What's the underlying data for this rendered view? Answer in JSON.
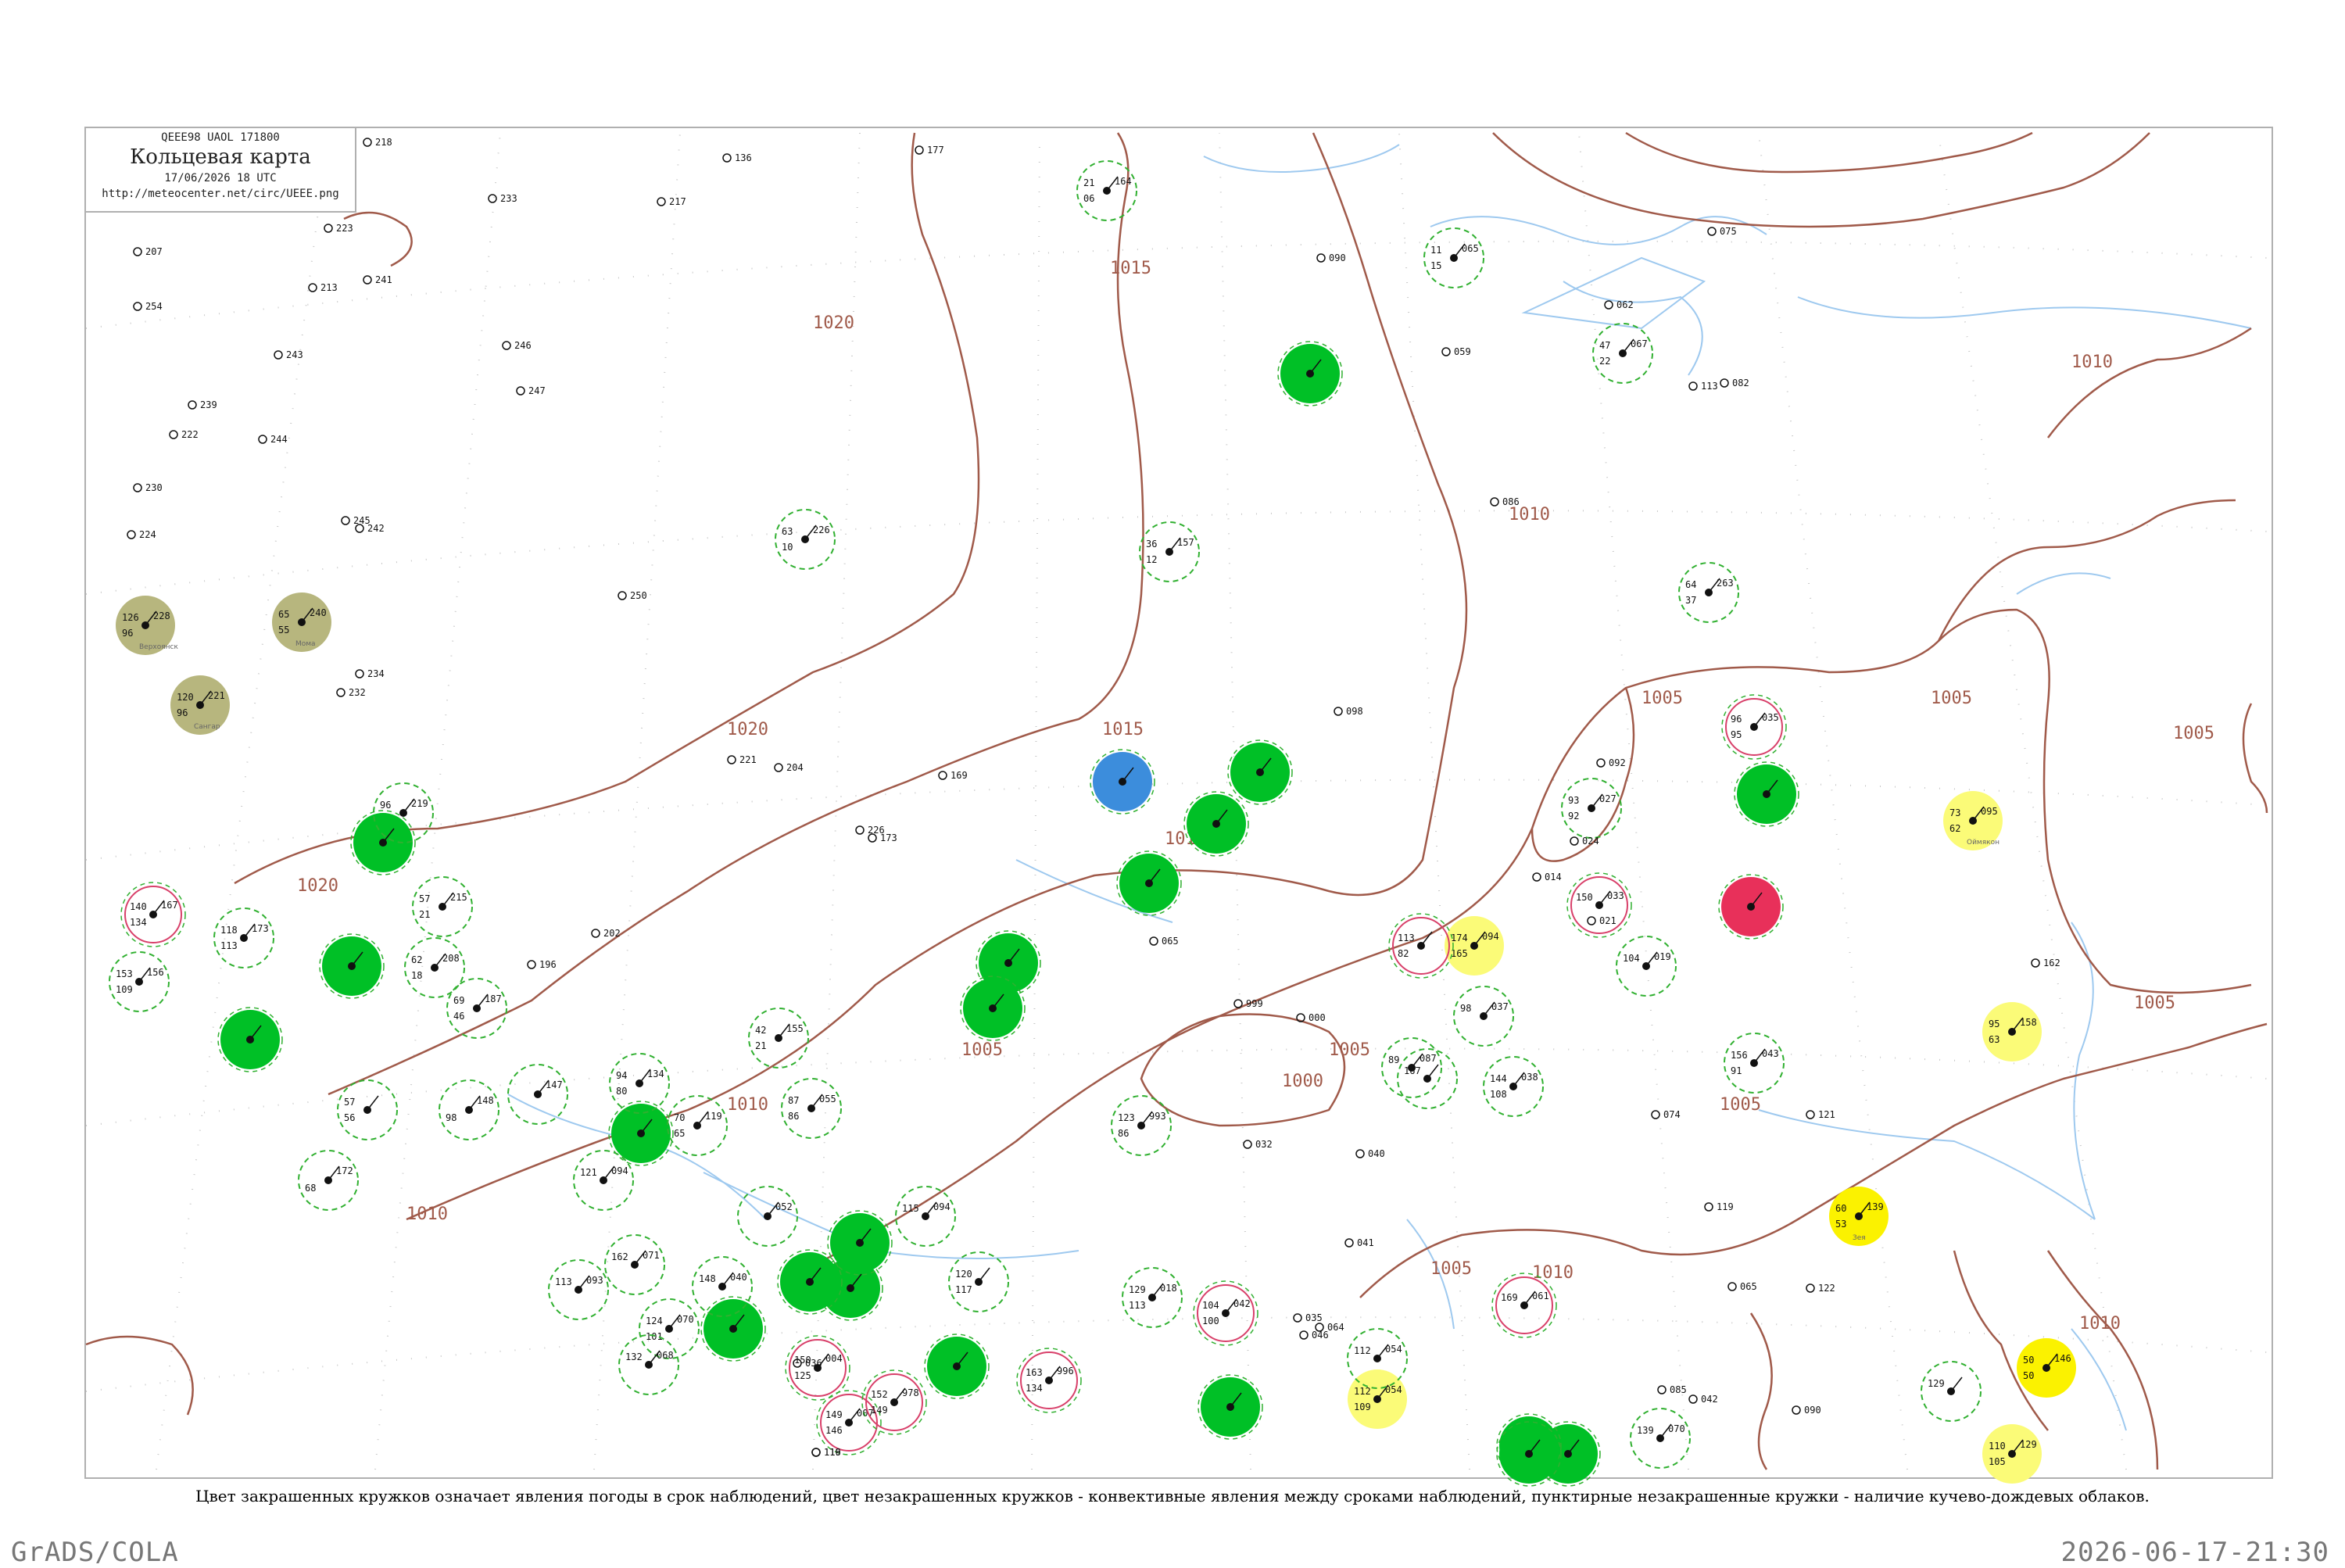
{
  "header": {
    "code": "QEEE98 UAOL 171800",
    "title": "Кольцевая карта",
    "date": "17/06/2026 18 UTC",
    "url": "http://meteocenter.net/circ/UEEE.png"
  },
  "caption": "Цвет закрашенных кружков означает явления погоды в срок наблюдений, цвет незакрашенных кружков - конвективные явления между сроками наблюдений, пунктирные незакрашенные кружки - наличие кучево-дождевых облаков.",
  "footer": {
    "left": "GrADS/COLA",
    "right": "2026-06-17-21:30"
  },
  "colors": {
    "isobar": "#a05a4a",
    "river": "#9ec9ef",
    "frame": "#b0b0b0",
    "grid_dots": "#c8c8c8",
    "fill_green": "#00c026",
    "fill_blue": "#3c8ddc",
    "fill_red": "#e8305a",
    "fill_yellow": "#fbfb78",
    "fill_bright_yellow": "#fbf200",
    "fill_olive": "#b7b67e",
    "ring_green_dashed": "#30b030",
    "ring_red": "#d8406a"
  },
  "isobar_labels": [
    "1020",
    "1020",
    "1020",
    "1015",
    "1015",
    "1015",
    "1010",
    "1010",
    "1010",
    "1010",
    "1010",
    "1005",
    "1005",
    "1005",
    "1005",
    "1005",
    "1005",
    "1005",
    "1005",
    "1000",
    "1010"
  ],
  "stations": [
    {
      "marker": "olive",
      "pressure": "228",
      "temp": "126",
      "dew": "96",
      "name": "Верхоянск"
    },
    {
      "marker": "olive",
      "pressure": "240",
      "temp": "65",
      "dew": "55",
      "name": "Мома"
    },
    {
      "marker": "olive",
      "pressure": "221",
      "temp": "120",
      "dew": "96",
      "name": "Сангар"
    },
    {
      "marker": "green",
      "pressure": "",
      "temp": "",
      "dew": "",
      "name": ""
    },
    {
      "marker": "green",
      "pressure": "",
      "temp": "",
      "dew": "",
      "name": ""
    },
    {
      "marker": "green",
      "pressure": "",
      "temp": "",
      "dew": "",
      "name": ""
    },
    {
      "marker": "green",
      "pressure": "",
      "temp": "",
      "dew": "",
      "name": ""
    },
    {
      "marker": "green",
      "pressure": "",
      "temp": "",
      "dew": "",
      "name": ""
    },
    {
      "marker": "green",
      "pressure": "",
      "temp": "",
      "dew": "",
      "name": ""
    },
    {
      "marker": "green",
      "pressure": "",
      "temp": "",
      "dew": "",
      "name": ""
    },
    {
      "marker": "green",
      "pressure": "",
      "temp": "",
      "dew": "",
      "name": ""
    },
    {
      "marker": "green",
      "pressure": "",
      "temp": "",
      "dew": "",
      "name": ""
    },
    {
      "marker": "green",
      "pressure": "",
      "temp": "",
      "dew": "",
      "name": ""
    },
    {
      "marker": "green",
      "pressure": "",
      "temp": "",
      "dew": "",
      "name": ""
    },
    {
      "marker": "green",
      "pressure": "",
      "temp": "",
      "dew": "",
      "name": ""
    },
    {
      "marker": "green",
      "pressure": "",
      "temp": "",
      "dew": "",
      "name": ""
    },
    {
      "marker": "green",
      "pressure": "",
      "temp": "",
      "dew": "",
      "name": ""
    },
    {
      "marker": "green",
      "pressure": "",
      "temp": "",
      "dew": "",
      "name": ""
    },
    {
      "marker": "green",
      "pressure": "",
      "temp": "",
      "dew": "",
      "name": ""
    },
    {
      "marker": "green",
      "pressure": "",
      "temp": "",
      "dew": "",
      "name": ""
    },
    {
      "marker": "green",
      "pressure": "",
      "temp": "",
      "dew": "",
      "name": ""
    },
    {
      "marker": "green",
      "pressure": "",
      "temp": "",
      "dew": "",
      "name": ""
    },
    {
      "marker": "green",
      "pressure": "",
      "temp": "",
      "dew": "",
      "name": ""
    },
    {
      "marker": "blue",
      "pressure": "",
      "temp": "",
      "dew": "",
      "name": ""
    },
    {
      "marker": "red",
      "pressure": "",
      "temp": "",
      "dew": "",
      "name": ""
    },
    {
      "marker": "yellow",
      "pressure": "094",
      "temp": "174",
      "dew": "165",
      "name": ""
    },
    {
      "marker": "yellow",
      "pressure": "095",
      "temp": "73",
      "dew": "62",
      "name": "Оймякон"
    },
    {
      "marker": "yellow",
      "pressure": "158",
      "temp": "95",
      "dew": "63",
      "name": ""
    },
    {
      "marker": "yellow",
      "pressure": "054",
      "temp": "112",
      "dew": "109",
      "name": ""
    },
    {
      "marker": "yellow",
      "pressure": "129",
      "temp": "110",
      "dew": "105",
      "name": ""
    },
    {
      "marker": "bright_yellow",
      "pressure": "139",
      "temp": "60",
      "dew": "53",
      "name": "Зея"
    },
    {
      "marker": "bright_yellow",
      "pressure": "146",
      "temp": "50",
      "dew": "50",
      "name": ""
    },
    {
      "marker": "ring_green",
      "pressure": "226",
      "temp": "63",
      "dew": "10",
      "name": ""
    },
    {
      "marker": "ring_green",
      "pressure": "164",
      "temp": "21",
      "dew": "06",
      "name": ""
    },
    {
      "marker": "ring_green",
      "pressure": "065",
      "temp": "11",
      "dew": "15",
      "name": ""
    },
    {
      "marker": "ring_green",
      "pressure": "067",
      "temp": "47",
      "dew": "22",
      "name": ""
    },
    {
      "marker": "ring_green",
      "pressure": "157",
      "temp": "36",
      "dew": "12",
      "name": ""
    },
    {
      "marker": "ring_green",
      "pressure": "263",
      "temp": "64",
      "dew": "37",
      "name": ""
    },
    {
      "marker": "ring_green",
      "pressure": "027",
      "temp": "93",
      "dew": "92",
      "name": ""
    },
    {
      "marker": "ring_green",
      "pressure": "219",
      "temp": "96",
      "dew": "",
      "name": ""
    },
    {
      "marker": "ring_green",
      "pressure": "215",
      "temp": "57",
      "dew": "21",
      "name": ""
    },
    {
      "marker": "ring_green",
      "pressure": "208",
      "temp": "62",
      "dew": "18",
      "name": ""
    },
    {
      "marker": "ring_green",
      "pressure": "156",
      "temp": "153",
      "dew": "109",
      "name": ""
    },
    {
      "marker": "ring_green",
      "pressure": "173",
      "temp": "118",
      "dew": "113",
      "name": ""
    },
    {
      "marker": "ring_green",
      "pressure": "187",
      "temp": "69",
      "dew": "46",
      "name": ""
    },
    {
      "marker": "ring_green",
      "pressure": "155",
      "temp": "42",
      "dew": "21",
      "name": ""
    },
    {
      "marker": "ring_green",
      "pressure": "055",
      "temp": "87",
      "dew": "86",
      "name": ""
    },
    {
      "marker": "ring_green",
      "pressure": "134",
      "temp": "94",
      "dew": "80",
      "name": ""
    },
    {
      "marker": "ring_green",
      "pressure": "119",
      "temp": "70",
      "dew": "65",
      "name": ""
    },
    {
      "marker": "ring_green",
      "pressure": "148",
      "temp": "",
      "dew": "98",
      "name": ""
    },
    {
      "marker": "ring_green",
      "pressure": "",
      "temp": "57",
      "dew": "56",
      "name": ""
    },
    {
      "marker": "ring_green",
      "pressure": "147",
      "temp": "",
      "dew": "",
      "name": ""
    },
    {
      "marker": "ring_green",
      "pressure": "172",
      "temp": "",
      "dew": "68",
      "name": ""
    },
    {
      "marker": "ring_green",
      "pressure": "094",
      "temp": "121",
      "dew": "",
      "name": ""
    },
    {
      "marker": "ring_green",
      "pressure": "071",
      "temp": "162",
      "dew": "",
      "name": ""
    },
    {
      "marker": "ring_green",
      "pressure": "093",
      "temp": "113",
      "dew": "",
      "name": ""
    },
    {
      "marker": "ring_green",
      "pressure": "070",
      "temp": "124",
      "dew": "101",
      "name": ""
    },
    {
      "marker": "ring_green",
      "pressure": "068",
      "temp": "132",
      "dew": "",
      "name": ""
    },
    {
      "marker": "ring_green",
      "pressure": "094",
      "temp": "115",
      "dew": "",
      "name": ""
    },
    {
      "marker": "ring_green",
      "pressure": "052",
      "temp": "",
      "dew": "",
      "name": ""
    },
    {
      "marker": "ring_green",
      "pressure": "040",
      "temp": "148",
      "dew": "",
      "name": ""
    },
    {
      "marker": "ring_green",
      "pressure": "",
      "temp": "120",
      "dew": "117",
      "name": ""
    },
    {
      "marker": "ring_green",
      "pressure": "993",
      "temp": "123",
      "dew": "86",
      "name": ""
    },
    {
      "marker": "ring_green",
      "pressure": "018",
      "temp": "129",
      "dew": "113",
      "name": ""
    },
    {
      "marker": "ring_green",
      "pressure": "037",
      "temp": "98",
      "dew": "",
      "name": ""
    },
    {
      "marker": "ring_green",
      "pressure": "087",
      "temp": "89",
      "dew": "",
      "name": ""
    },
    {
      "marker": "ring_green",
      "pressure": "",
      "temp": "167",
      "dew": "",
      "name": ""
    },
    {
      "marker": "ring_green",
      "pressure": "038",
      "temp": "144",
      "dew": "108",
      "name": ""
    },
    {
      "marker": "ring_green",
      "pressure": "019",
      "temp": "104",
      "dew": "",
      "name": ""
    },
    {
      "marker": "ring_green",
      "pressure": "043",
      "temp": "156",
      "dew": "91",
      "name": ""
    },
    {
      "marker": "ring_green",
      "pressure": "",
      "temp": "129",
      "dew": "",
      "name": ""
    },
    {
      "marker": "ring_green",
      "pressure": "070",
      "temp": "139",
      "dew": "",
      "name": ""
    },
    {
      "marker": "ring_green",
      "pressure": "054",
      "temp": "112",
      "dew": "",
      "name": ""
    },
    {
      "marker": "ring_red",
      "pressure": "035",
      "temp": "96",
      "dew": "95",
      "name": ""
    },
    {
      "marker": "ring_red",
      "pressure": "033",
      "temp": "150",
      "dew": "",
      "name": ""
    },
    {
      "marker": "ring_red",
      "pressure": "",
      "temp": "113",
      "dew": "82",
      "name": ""
    },
    {
      "marker": "ring_red",
      "pressure": "167",
      "temp": "140",
      "dew": "134",
      "name": ""
    },
    {
      "marker": "ring_red",
      "pressure": "061",
      "temp": "169",
      "dew": "",
      "name": ""
    },
    {
      "marker": "ring_red",
      "pressure": "042",
      "temp": "104",
      "dew": "100",
      "name": ""
    },
    {
      "marker": "ring_red",
      "pressure": "004",
      "temp": "150",
      "dew": "125",
      "name": ""
    },
    {
      "marker": "ring_red",
      "pressure": "007",
      "temp": "149",
      "dew": "146",
      "name": ""
    },
    {
      "marker": "ring_red",
      "pressure": "996",
      "temp": "163",
      "dew": "134",
      "name": ""
    },
    {
      "marker": "ring_red",
      "pressure": "978",
      "temp": "152",
      "dew": "149",
      "name": ""
    }
  ],
  "plain_labels": [
    "218",
    "233",
    "217",
    "136",
    "177",
    "223",
    "207",
    "254",
    "241",
    "213",
    "246",
    "247",
    "243",
    "239",
    "244",
    "222",
    "230",
    "224",
    "242",
    "245",
    "250",
    "232",
    "234",
    "202",
    "196",
    "169",
    "221",
    "204",
    "226",
    "173",
    "098",
    "090",
    "059",
    "086",
    "062",
    "075",
    "113",
    "082",
    "092",
    "162",
    "065",
    "014",
    "021",
    "000",
    "999",
    "032",
    "040",
    "041",
    "064",
    "046",
    "035",
    "074",
    "119",
    "121",
    "036",
    "116",
    "119",
    "042",
    "085",
    "090",
    "122",
    "065",
    "024"
  ]
}
